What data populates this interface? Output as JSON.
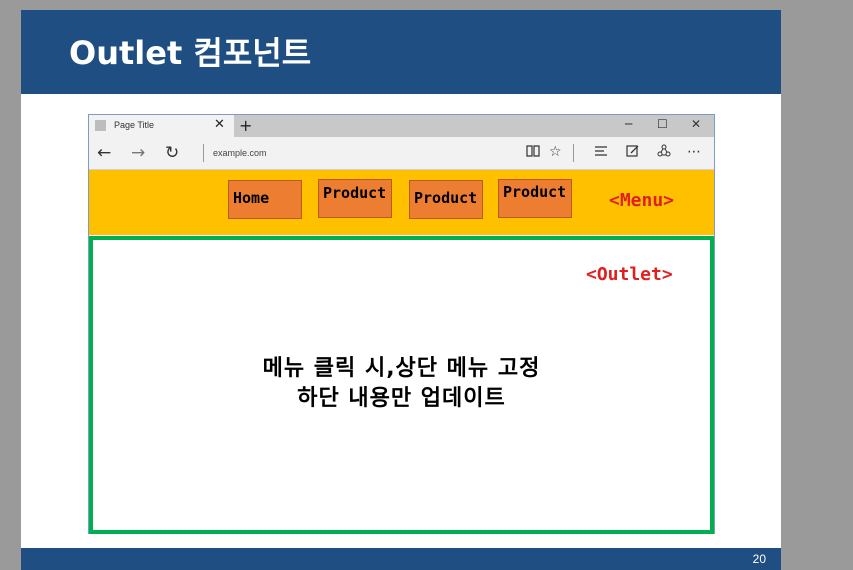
{
  "slide": {
    "title": "Outlet 컴포넌트",
    "page_number": "20",
    "colors": {
      "header": "#1f4e82",
      "menu_bar": "#ffc000",
      "menu_button": "#ed7d31",
      "outlet_border": "#00b050",
      "label_red": "#e02020"
    }
  },
  "browser": {
    "tab_title": "Page Title",
    "tab_close": "✕",
    "new_tab": "+",
    "window_controls": {
      "minimize": "─",
      "maximize": "☐",
      "close": "✕"
    },
    "nav": {
      "back": "←",
      "forward": "→",
      "refresh": "↻"
    },
    "url": "example.com",
    "tools": {
      "reading_view": "📖",
      "favorite": "☆",
      "hub": "☰",
      "web_note": "✎",
      "share": "⟲",
      "more": "⋯"
    }
  },
  "menu": {
    "items": [
      "Home",
      "Product",
      "Product",
      "Product"
    ],
    "label": "<Menu>"
  },
  "outlet": {
    "label": "<Outlet>",
    "line1": "메뉴 클릭 시,상단 메뉴 고정",
    "line2": "하단 내용만 업데이트"
  }
}
